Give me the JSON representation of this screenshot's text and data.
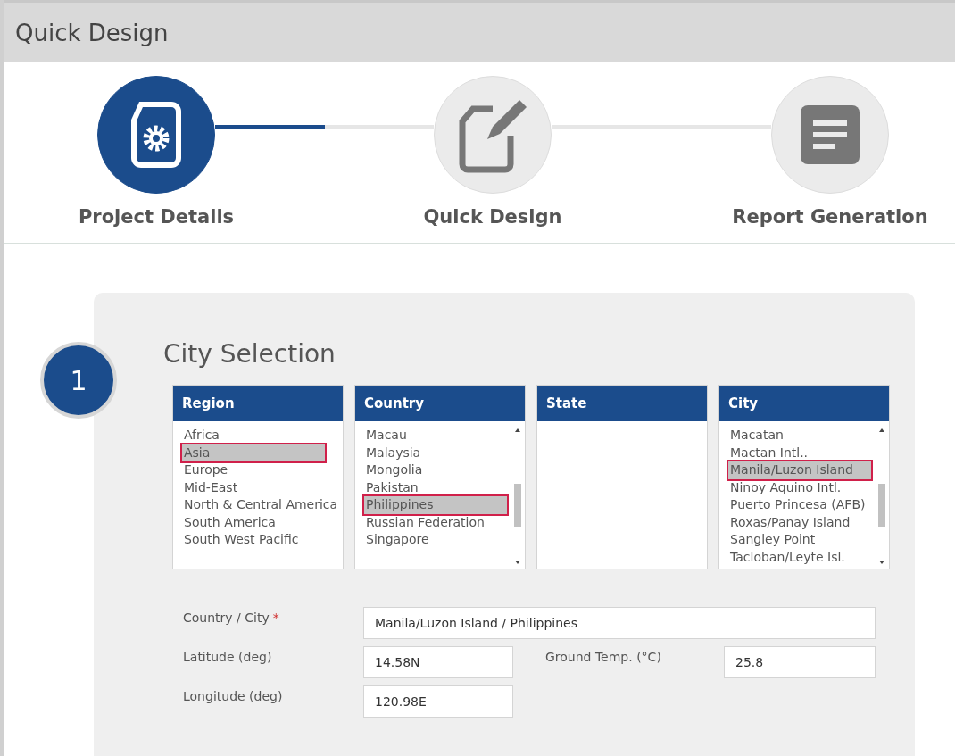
{
  "window": {
    "title": "Quick Design"
  },
  "steps": [
    {
      "label": "Project Details",
      "kind": "settings",
      "selected": true
    },
    {
      "label": "Quick Design",
      "kind": "edit",
      "selected": false
    },
    {
      "label": "Report Generation",
      "kind": "report",
      "selected": false
    }
  ],
  "connectors": [
    {
      "level": 0.5
    }
  ],
  "section": {
    "number": "1",
    "title": "City Selection"
  },
  "lists": [
    {
      "header": "Region",
      "items": [
        {
          "label": "Africa",
          "selected": false
        },
        {
          "label": "Asia",
          "selected": true
        },
        {
          "label": "Europe",
          "selected": false
        },
        {
          "label": "Mid-East",
          "selected": false
        },
        {
          "label": "North & Central America",
          "selected": false
        },
        {
          "label": "South America",
          "selected": false
        },
        {
          "label": "South West Pacific",
          "selected": false
        }
      ]
    },
    {
      "header": "Country",
      "items": [
        {
          "label": "Macau",
          "selected": false
        },
        {
          "label": "Malaysia",
          "selected": false
        },
        {
          "label": "Mongolia",
          "selected": false
        },
        {
          "label": "Pakistan",
          "selected": false
        },
        {
          "label": "Philippines",
          "selected": true
        },
        {
          "label": "Russian Federation",
          "selected": false
        },
        {
          "label": "Singapore",
          "selected": false
        }
      ]
    },
    {
      "header": "State"
    },
    {
      "header": "City",
      "items": [
        {
          "label": "Macatan",
          "selected": false
        },
        {
          "label": "Mactan Intl..",
          "selected": false
        },
        {
          "label": "Manila/Luzon Island",
          "selected": true
        },
        {
          "label": "Ninoy Aquino Intl.",
          "selected": false
        },
        {
          "label": "Puerto Princesa (AFB)",
          "selected": false
        },
        {
          "label": "Roxas/Panay Island",
          "selected": false
        },
        {
          "label": "Sangley Point",
          "selected": false
        },
        {
          "label": "Tacloban/Leyte Isl.",
          "selected": false
        }
      ]
    }
  ],
  "fields": {
    "country_city": {
      "label": "Country / City",
      "required_mark": "*",
      "value": "Manila/Luzon Island / Philippines"
    },
    "latitude": {
      "label": "Latitude (deg)",
      "value": "14.58N"
    },
    "ground_temp": {
      "label": "Ground Temp. (°C)",
      "value": "25.8"
    },
    "longitude": {
      "label": "Longitude (deg)",
      "value": "120.98E"
    }
  }
}
